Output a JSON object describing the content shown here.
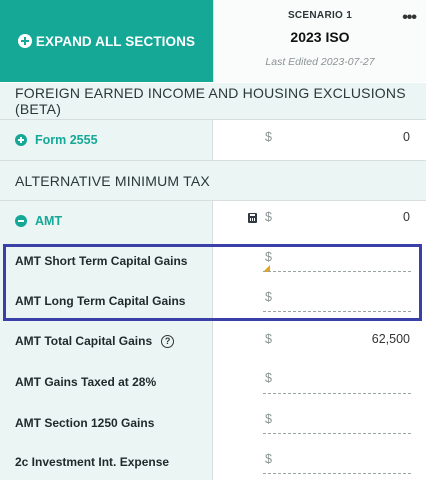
{
  "toolbar": {
    "expand_label": "EXPAND ALL SECTIONS"
  },
  "scenario": {
    "label": "SCENARIO 1",
    "name": "2023 ISO",
    "edited": "Last Edited 2023-07-27",
    "menu": "•••"
  },
  "sections": {
    "foreign": {
      "title": "FOREIGN EARNED INCOME AND HOUSING EXCLUSIONS (BETA)"
    },
    "amt": {
      "title": "ALTERNATIVE MINIMUM TAX"
    }
  },
  "rows": {
    "form2555": {
      "label": "Form 2555",
      "currency": "$",
      "value": "0"
    },
    "amt": {
      "label": "AMT",
      "currency": "$",
      "value": "0"
    },
    "amt_st": {
      "label": "AMT Short Term Capital Gains",
      "currency": "$"
    },
    "amt_lt": {
      "label": "AMT Long Term Capital Gains",
      "currency": "$"
    },
    "amt_total": {
      "label": "AMT Total Capital Gains",
      "currency": "$",
      "value": "62,500",
      "help": "?"
    },
    "amt_28": {
      "label": "AMT Gains Taxed at 28%",
      "currency": "$"
    },
    "amt_1250": {
      "label": "AMT Section 1250 Gains",
      "currency": "$"
    },
    "inv_int": {
      "label": "2c Investment Int. Expense",
      "currency": "$"
    }
  },
  "colors": {
    "accent": "#16a897",
    "highlight": "#3b3fa8",
    "flag": "#e2a51f"
  }
}
